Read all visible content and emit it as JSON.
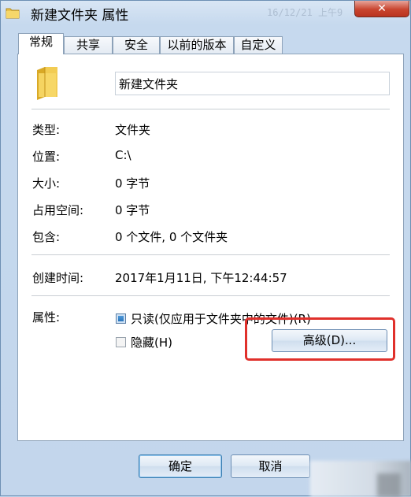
{
  "window": {
    "title": "新建文件夹 属性",
    "background_text": "16/12/21 上午9",
    "close_icon": "✕"
  },
  "tabs": [
    {
      "label": "常规",
      "active": true
    },
    {
      "label": "共享",
      "active": false
    },
    {
      "label": "安全",
      "active": false
    },
    {
      "label": "以前的版本",
      "active": false
    },
    {
      "label": "自定义",
      "active": false
    }
  ],
  "general": {
    "folder_name": "新建文件夹",
    "rows": [
      {
        "label": "类型:",
        "value": "文件夹"
      },
      {
        "label": "位置:",
        "value": "C:\\"
      },
      {
        "label": "大小:",
        "value": "0 字节"
      },
      {
        "label": "占用空间:",
        "value": "0 字节"
      },
      {
        "label": "包含:",
        "value": "0 个文件, 0 个文件夹"
      }
    ],
    "created_label": "创建时间:",
    "created_value": "2017年1月11日, 下午12:44:57",
    "attributes_label": "属性:",
    "readonly_label": "只读(仅应用于文件夹中的文件)(R)",
    "readonly_checked": true,
    "hidden_label": "隐藏(H)",
    "hidden_checked": false,
    "advanced_button": "高级(D)..."
  },
  "footer": {
    "ok_button": "确定",
    "cancel_button": "取消"
  },
  "colors": {
    "accent": "#1f6cb5",
    "highlight": "#e0302b"
  }
}
